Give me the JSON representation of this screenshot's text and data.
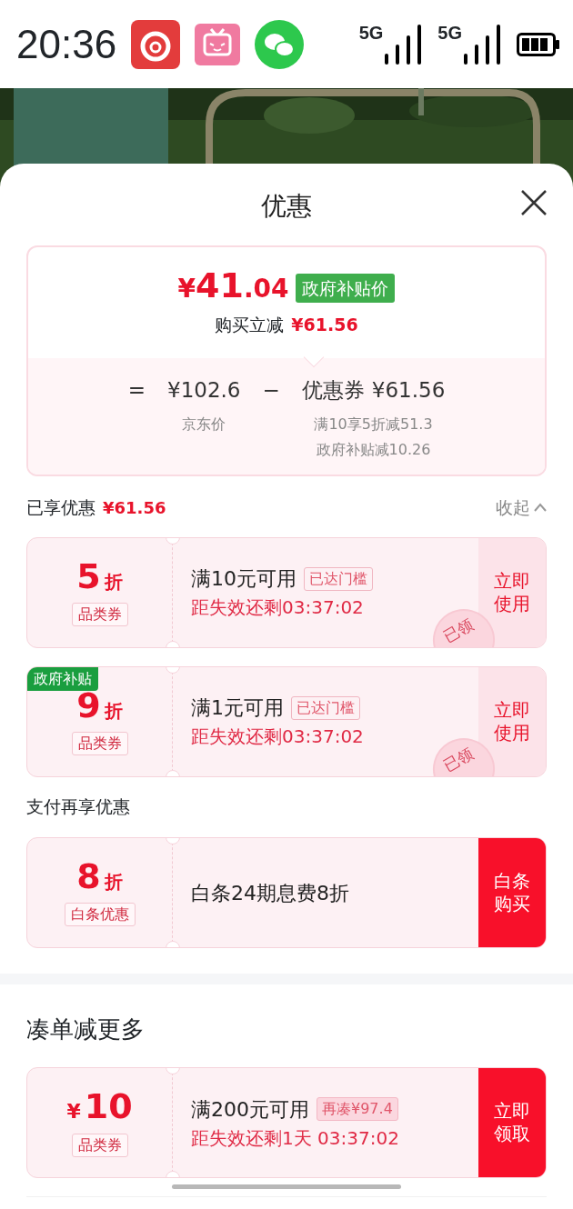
{
  "status_bar": {
    "time": "20:36",
    "networks": [
      "5G",
      "5G"
    ]
  },
  "sheet": {
    "title": "优惠"
  },
  "summary": {
    "currency": "¥",
    "price_int": "41",
    "price_dec": ".04",
    "price_tag": "政府补贴价",
    "reduce_label": "购买立减",
    "reduce_amount": "¥61.56",
    "equals": "=",
    "base_price": "¥102.6",
    "base_label": "京东价",
    "minus": "−",
    "coupon_label": "优惠券",
    "coupon_amount": "¥61.56",
    "details": [
      "满10享5折减51.3",
      "政府补贴减10.26"
    ]
  },
  "sections": [
    {
      "kind": "enjoyed",
      "title": "已享优惠",
      "amount": "¥61.56",
      "toggle": "收起",
      "expanded": true,
      "coupons": [
        {
          "kind": "met",
          "value": "5",
          "suffix": "折",
          "type": "品类券",
          "condition": "满10元可用",
          "tag": "已达门槛",
          "expiry": "距失效还剩03:37:02",
          "button": "立即使用",
          "claimed": true,
          "stamp": "已领"
        },
        {
          "kind": "met",
          "badge": "政府补贴",
          "value": "9",
          "suffix": "折",
          "type": "品类券",
          "condition": "满1元可用",
          "tag": "已达门槛",
          "expiry": "距失效还剩03:37:02",
          "button": "立即使用",
          "claimed": true,
          "stamp": "已领"
        }
      ]
    },
    {
      "kind": "subtitle",
      "title": "支付再享优惠",
      "coupons": [
        {
          "value": "8",
          "suffix": "折",
          "type": "白条优惠",
          "condition": "白条24期息费8折",
          "button": "白条购买",
          "claimed": false
        }
      ]
    },
    {
      "kind": "title",
      "title": "凑单减更多",
      "coupons": [
        {
          "kind": "short",
          "prefix": "¥",
          "value": "10",
          "type": "品类券",
          "condition": "满200元可用",
          "tag": "再凑¥97.4",
          "expiry": "距失效还剩1天 03:37:02",
          "button": "立即领取",
          "claimed": false
        }
      ]
    }
  ]
}
